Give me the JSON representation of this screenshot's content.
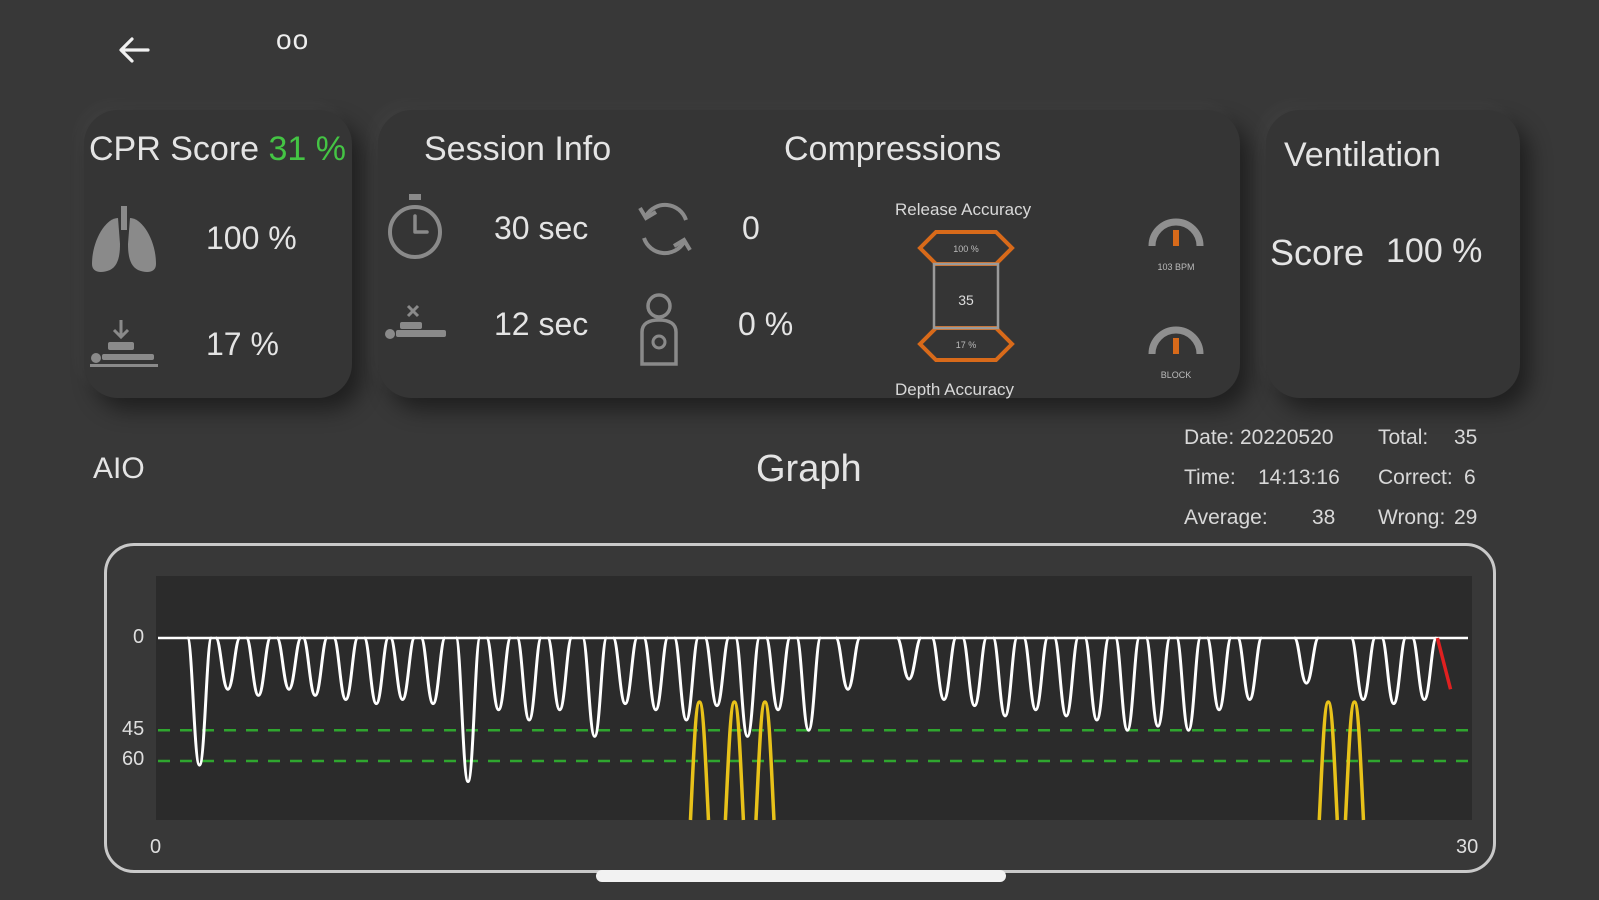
{
  "header": {
    "title": "oo"
  },
  "cpr": {
    "title": "CPR Score",
    "score": "31 %",
    "ventilation_pct": "100 %",
    "compression_pct": "17 %"
  },
  "session": {
    "title": "Session Info",
    "duration": "30 sec",
    "cycles": "0",
    "idle": "12 sec",
    "hand_pos": "0 %"
  },
  "compressions": {
    "title": "Compressions",
    "release_label": "Release Accuracy",
    "release_pct": "100 %",
    "count": "35",
    "depth_pct": "17 %",
    "depth_label": "Depth Accuracy",
    "rate_label": "103 BPM",
    "block_label": "BLOCK"
  },
  "ventilation": {
    "title": "Ventilation",
    "score_label": "Score",
    "score_value": "100 %"
  },
  "graph_section": {
    "mode": "AIO",
    "title": "Graph",
    "date_label": "Date:",
    "date_value": "20220520",
    "time_label": "Time:",
    "time_value": "14:13:16",
    "average_label": "Average:",
    "average_value": "38",
    "total_label": "Total:",
    "total_value": "35",
    "correct_label": "Correct:",
    "correct_value": "6",
    "wrong_label": "Wrong:",
    "wrong_value": "29"
  },
  "chart_data": {
    "type": "line",
    "x_range": [
      0,
      30
    ],
    "y_range_depth_mm": [
      0,
      75
    ],
    "y_ticks": [
      "0",
      "45",
      "60"
    ],
    "x_ticks": [
      "0",
      "30"
    ],
    "target_band": [
      45,
      60
    ],
    "compression_depths": [
      {
        "t": 0.95,
        "d": 62
      },
      {
        "t": 1.6,
        "d": 25
      },
      {
        "t": 2.3,
        "d": 28
      },
      {
        "t": 3.0,
        "d": 25
      },
      {
        "t": 3.6,
        "d": 28
      },
      {
        "t": 4.3,
        "d": 30
      },
      {
        "t": 5.0,
        "d": 32
      },
      {
        "t": 5.6,
        "d": 30
      },
      {
        "t": 6.3,
        "d": 32
      },
      {
        "t": 7.1,
        "d": 70
      },
      {
        "t": 7.8,
        "d": 35
      },
      {
        "t": 8.5,
        "d": 40
      },
      {
        "t": 9.2,
        "d": 35
      },
      {
        "t": 10.0,
        "d": 48
      },
      {
        "t": 10.7,
        "d": 32
      },
      {
        "t": 11.4,
        "d": 35
      },
      {
        "t": 12.1,
        "d": 40
      },
      {
        "t": 12.8,
        "d": 33
      },
      {
        "t": 13.5,
        "d": 48
      },
      {
        "t": 14.2,
        "d": 35
      },
      {
        "t": 14.9,
        "d": 45
      },
      {
        "t": 15.8,
        "d": 25
      },
      {
        "t": 17.2,
        "d": 20
      },
      {
        "t": 18.0,
        "d": 30
      },
      {
        "t": 18.7,
        "d": 33
      },
      {
        "t": 19.4,
        "d": 38
      },
      {
        "t": 20.1,
        "d": 35
      },
      {
        "t": 20.8,
        "d": 38
      },
      {
        "t": 21.5,
        "d": 40
      },
      {
        "t": 22.2,
        "d": 45
      },
      {
        "t": 22.9,
        "d": 43
      },
      {
        "t": 23.6,
        "d": 45
      },
      {
        "t": 24.3,
        "d": 35
      },
      {
        "t": 25.0,
        "d": 30
      },
      {
        "t": 26.3,
        "d": 22
      },
      {
        "t": 27.6,
        "d": 30
      },
      {
        "t": 28.3,
        "d": 32
      },
      {
        "t": 29.0,
        "d": 30
      }
    ],
    "ventilation_spikes_t": [
      12.4,
      13.2,
      13.9,
      26.8,
      27.4
    ],
    "current_segment": {
      "t0": 29.3,
      "t1": 29.6,
      "d": 25
    }
  },
  "colors": {
    "background": "#383838",
    "accent_green": "#44c444",
    "gauge_orange": "#d86a1a",
    "vent_yellow": "#e8c21a",
    "alert_red": "#e02020"
  }
}
